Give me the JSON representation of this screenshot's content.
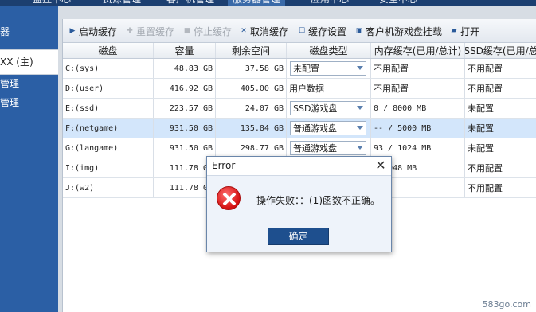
{
  "topnav": {
    "tabs": [
      {
        "label": "监控中心"
      },
      {
        "label": "资源管理"
      },
      {
        "label": "客户机管理"
      },
      {
        "label": "服务器管理",
        "active": true
      },
      {
        "label": "应用中心"
      },
      {
        "label": "安全中心"
      }
    ]
  },
  "sidebar": {
    "items": [
      {
        "label": "器"
      },
      {
        "label": "XX (主)",
        "selected": true
      },
      {
        "label": "管理"
      },
      {
        "label": "管理"
      }
    ]
  },
  "toolbar": {
    "start_cache": "启动缓存",
    "reset_cache": "重置缓存",
    "stop_cache": "停止缓存",
    "cancel_cache": "取消缓存",
    "cache_settings": "缓存设置",
    "client_game_mount": "客户机游戏盘挂载",
    "open": "打开"
  },
  "table": {
    "headers": [
      "磁盘",
      "容量",
      "剩余空间",
      "磁盘类型",
      "内存缓存(已用/总计)",
      "SSD缓存(已用/总"
    ],
    "rows": [
      {
        "disk": "C:(sys)",
        "capacity": "48.83 GB",
        "free": "37.58 GB",
        "type": "未配置",
        "type_select": true,
        "mem_cache": "不用配置",
        "ssd_cache": "不用配置"
      },
      {
        "disk": "D:(user)",
        "capacity": "416.92 GB",
        "free": "405.00 GB",
        "type": "用户数据",
        "type_select": false,
        "mem_cache": "不用配置",
        "ssd_cache": "不用配置"
      },
      {
        "disk": "E:(ssd)",
        "capacity": "223.57 GB",
        "free": "24.07 GB",
        "type": "SSD游戏盘",
        "type_select": true,
        "mem_cache": "0 / 8000 MB",
        "ssd_cache": "未配置"
      },
      {
        "disk": "F:(netgame)",
        "capacity": "931.50 GB",
        "free": "135.84 GB",
        "type": "普通游戏盘",
        "type_select": true,
        "mem_cache": "-- / 5000 MB",
        "ssd_cache": "未配置",
        "selected": true
      },
      {
        "disk": "G:(langame)",
        "capacity": "931.50 GB",
        "free": "298.77 GB",
        "type": "普通游戏盘",
        "type_select": true,
        "mem_cache": "93 / 1024 MB",
        "ssd_cache": "未配置"
      },
      {
        "disk": "I:(img)",
        "capacity": "111.78 GB",
        "free": "",
        "type": "",
        "type_select": false,
        "mem_cache": "/ 2048 MB",
        "ssd_cache": "不用配置"
      },
      {
        "disk": "J:(w2)",
        "capacity": "111.78 GB",
        "free": "",
        "type": "",
        "type_select": false,
        "mem_cache": "配置",
        "ssd_cache": "不用配置"
      }
    ]
  },
  "dialog": {
    "title": "Error",
    "close_glyph": "✕",
    "message": "操作失败：：(1)函数不正确。",
    "ok_label": "确定"
  },
  "watermark": "583go.com"
}
